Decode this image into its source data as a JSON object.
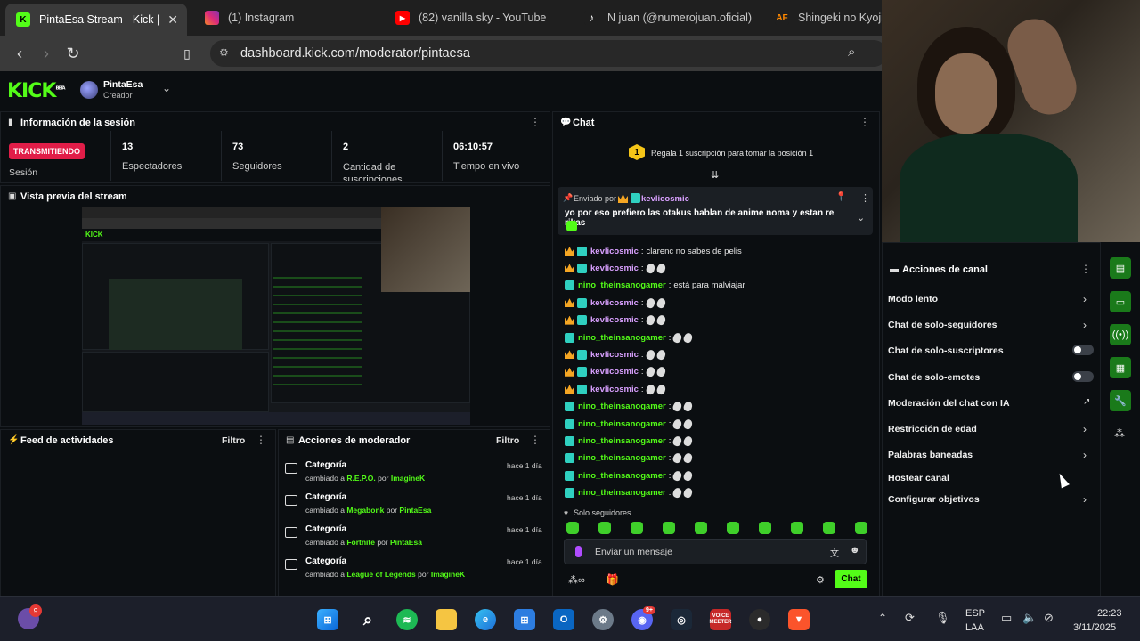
{
  "browser": {
    "tabs": [
      {
        "title": "PintaEsa Stream - Kick |",
        "icon": "kick-icon",
        "color": "#53fc18",
        "active": true
      },
      {
        "title": "(1) Instagram",
        "icon": "instagram-icon",
        "color": "#e1306c"
      },
      {
        "title": "(82) vanilla sky - YouTube",
        "icon": "youtube-icon",
        "color": "#ff0000"
      },
      {
        "title": "N juan (@numerojuan.oficial)",
        "icon": "tiktok-icon",
        "color": "#ffffff"
      },
      {
        "title": "Shingeki no Kyojin",
        "icon": "af-icon",
        "color": "#ff8800"
      }
    ],
    "url": "dashboard.kick.com/moderator/pintaesa"
  },
  "kick": {
    "logo": "KICK",
    "logo_sup": "BETA",
    "channel_name": "PintaEsa",
    "channel_role": "Creador"
  },
  "session": {
    "title": "Información de la sesión",
    "live_badge": "TRANSMITIENDO",
    "live_label": "Sesión",
    "stats": [
      {
        "value": "13",
        "label": "Espectadores"
      },
      {
        "value": "73",
        "label": "Seguidores"
      },
      {
        "value": "2",
        "label": "Cantidad de suscripciones"
      },
      {
        "value": "06:10:57",
        "label": "Tiempo en vivo"
      }
    ]
  },
  "preview": {
    "title": "Vista previa del stream"
  },
  "activity": {
    "title": "Feed de actividades",
    "filter": "Filtro"
  },
  "modactions": {
    "title": "Acciones de moderador",
    "filter": "Filtro",
    "items": [
      {
        "title": "Categoría",
        "time": "hace 1 día",
        "prefix": "cambiado a",
        "target": "R.E.P.O.",
        "by": "por",
        "user": "ImagineK"
      },
      {
        "title": "Categoría",
        "time": "hace 1 día",
        "prefix": "cambiado a",
        "target": "Megabonk",
        "by": "por",
        "user": "PintaEsa"
      },
      {
        "title": "Categoría",
        "time": "hace 1 día",
        "prefix": "cambiado a",
        "target": "Fortnite",
        "by": "por",
        "user": "PintaEsa"
      },
      {
        "title": "Categoría",
        "time": "hace 1 día",
        "prefix": "cambiado a",
        "target": "League of Legends",
        "by": "por",
        "user": "ImagineK"
      }
    ]
  },
  "chat": {
    "title": "Chat",
    "gift_rank": "1",
    "gift_text": "Regala 1 suscripción para tomar la posición 1",
    "pinned": {
      "sent_by": "Enviado por",
      "user": "kevlicosmic",
      "message": "yo por eso prefiero las otakus hablan de anime noma y estan re rikas"
    },
    "messages": [
      {
        "user": "kevlicosmic",
        "type": "u1",
        "crown": true,
        "text": "clarenc no sabes de pelis"
      },
      {
        "user": "kevlicosmic",
        "type": "u1",
        "crown": true,
        "text": ""
      },
      {
        "user": "nino_theinsanogamer",
        "type": "u2",
        "crown": false,
        "text": "está para malviajar"
      },
      {
        "user": "kevlicosmic",
        "type": "u1",
        "crown": true,
        "text": ""
      },
      {
        "user": "kevlicosmic",
        "type": "u1",
        "crown": true,
        "text": ""
      },
      {
        "user": "nino_theinsanogamer",
        "type": "u2",
        "crown": false,
        "text": ""
      },
      {
        "user": "kevlicosmic",
        "type": "u1",
        "crown": true,
        "text": ""
      },
      {
        "user": "kevlicosmic",
        "type": "u1",
        "crown": true,
        "text": ""
      },
      {
        "user": "kevlicosmic",
        "type": "u1",
        "crown": true,
        "text": ""
      },
      {
        "user": "nino_theinsanogamer",
        "type": "u2",
        "crown": false,
        "text": ""
      },
      {
        "user": "nino_theinsanogamer",
        "type": "u2",
        "crown": false,
        "text": ""
      },
      {
        "user": "nino_theinsanogamer",
        "type": "u2",
        "crown": false,
        "text": ""
      },
      {
        "user": "nino_theinsanogamer",
        "type": "u2",
        "crown": false,
        "text": ""
      },
      {
        "user": "nino_theinsanogamer",
        "type": "u2",
        "crown": false,
        "text": ""
      },
      {
        "user": "nino_theinsanogamer",
        "type": "u2",
        "crown": false,
        "text": ""
      }
    ],
    "mode_label": "Solo seguidores",
    "input_placeholder": "Enviar un mensaje",
    "send_label": "Chat"
  },
  "channel_actions": {
    "title": "Acciones de canal",
    "items": [
      {
        "label": "Modo lento",
        "control": "arrow"
      },
      {
        "label": "Chat de solo-seguidores",
        "control": "arrow"
      },
      {
        "label": "Chat de solo-suscriptores",
        "control": "toggle"
      },
      {
        "label": "Chat de solo-emotes",
        "control": "toggle"
      },
      {
        "label": "Moderación del chat con IA",
        "control": "external"
      },
      {
        "label": "Restricción de edad",
        "control": "arrow"
      },
      {
        "label": "Palabras baneadas",
        "control": "arrow"
      },
      {
        "label": "Hostear canal",
        "control": "none"
      },
      {
        "label": "Configurar objetivos",
        "control": "arrow"
      }
    ]
  },
  "taskbar": {
    "notification_count": "9",
    "language": "ESP",
    "language_sub": "LAA",
    "time": "22:23",
    "date": "3/11/2025",
    "discord_badge": "9+",
    "voicemeeter_label": "VOICE MEETER"
  }
}
